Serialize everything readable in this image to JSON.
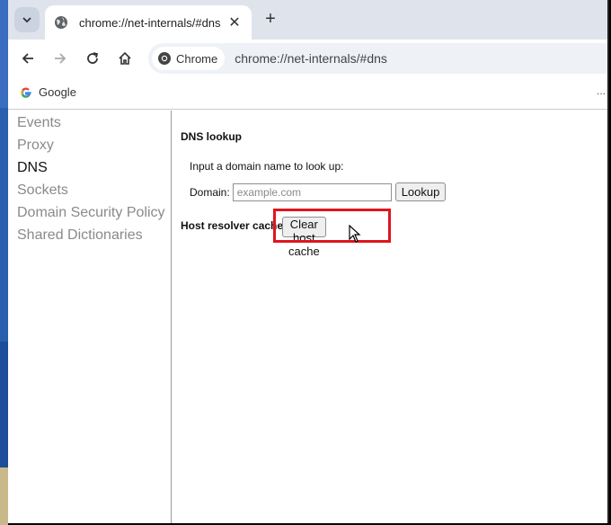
{
  "browser": {
    "tab": {
      "title": "chrome://net-internals/#dns"
    },
    "omnibox": {
      "chip_label": "Chrome",
      "url": "chrome://net-internals/#dns"
    },
    "bookmarks": [
      {
        "label": "Google"
      }
    ],
    "bookmarks_overflow": "..."
  },
  "sidebar": {
    "items": [
      {
        "label": "Events",
        "active": false
      },
      {
        "label": "Proxy",
        "active": false
      },
      {
        "label": "DNS",
        "active": true
      },
      {
        "label": "Sockets",
        "active": false
      },
      {
        "label": "Domain Security Policy",
        "active": false
      },
      {
        "label": "Shared Dictionaries",
        "active": false
      }
    ]
  },
  "dns": {
    "heading": "DNS lookup",
    "prompt": "Input a domain name to look up:",
    "domain_label": "Domain:",
    "domain_placeholder": "example.com",
    "domain_value": "",
    "lookup_button": "Lookup",
    "cache_heading": "Host resolver cache",
    "clear_button": "Clear host cache"
  },
  "colors": {
    "highlight": "#e0141e",
    "tabstrip": "#dfe4ec",
    "desktop": "#2a5fae"
  }
}
